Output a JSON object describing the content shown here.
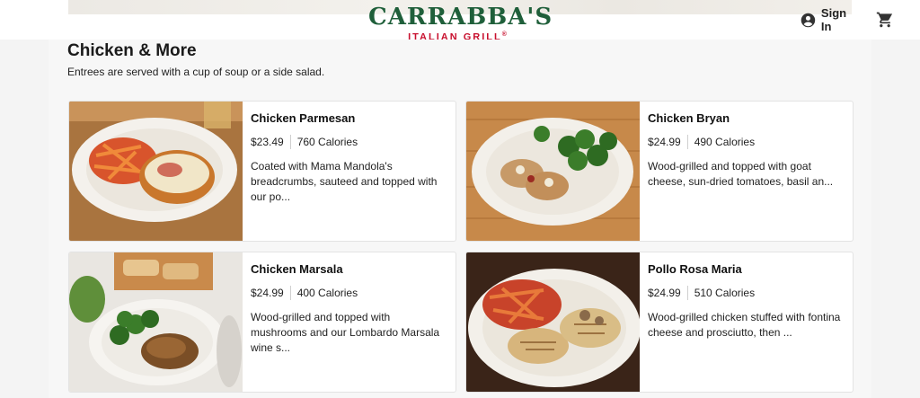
{
  "header": {
    "brand_name": "CARRABBA'S",
    "brand_sub": "ITALIAN GRILL",
    "registered_mark": "®",
    "signin_label": "Sign In",
    "account_icon": "account-circle-icon",
    "cart_icon": "shopping-cart-icon",
    "brand_green": "#1f5f3a",
    "brand_red": "#c8102e"
  },
  "section": {
    "title": "Chicken & More",
    "subtitle": "Entrees are served with a cup of soup or a side salad."
  },
  "items": [
    {
      "name": "Chicken Parmesan",
      "price": "$23.49",
      "calories": "760 Calories",
      "description": "Coated with Mama Mandola's breadcrumbs, sauteed and topped with our po..."
    },
    {
      "name": "Chicken Bryan",
      "price": "$24.99",
      "calories": "490 Calories",
      "description": "Wood-grilled and topped with goat cheese, sun-dried tomatoes, basil an..."
    },
    {
      "name": "Chicken Marsala",
      "price": "$24.99",
      "calories": "400 Calories",
      "description": "Wood-grilled and topped with mushrooms and our Lombardo Marsala wine s..."
    },
    {
      "name": "Pollo Rosa Maria",
      "price": "$24.99",
      "calories": "510 Calories",
      "description": "Wood-grilled chicken stuffed with fontina cheese and prosciutto, then ..."
    }
  ]
}
